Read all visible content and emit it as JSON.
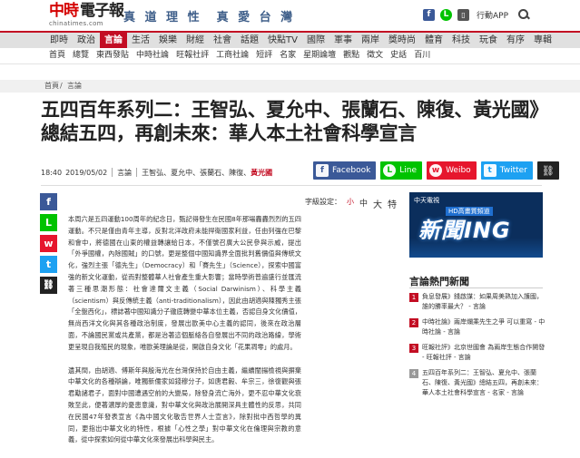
{
  "header": {
    "logo_main": "中時",
    "logo_sub": "電子報",
    "logo_url": "chinatimes.com",
    "slogan": "真 道 理 性　真 愛 台 灣",
    "app_label": "行動APP"
  },
  "nav": {
    "items": [
      "即時",
      "政治",
      "言論",
      "生活",
      "娛樂",
      "財經",
      "社會",
      "話題",
      "快點TV",
      "國際",
      "軍事",
      "兩岸",
      "獎時尚",
      "體育",
      "科技",
      "玩食",
      "有序",
      "專輯"
    ],
    "active_index": 2
  },
  "subnav": {
    "items": [
      "首頁",
      "總覽",
      "東西發貼",
      "中時社論",
      "旺報社評",
      "工商社論",
      "短評",
      "名家",
      "星期論壇",
      "觀點",
      "徵文",
      "史話",
      "百川"
    ]
  },
  "breadcrumb": {
    "home": "首頁",
    "section": "言論"
  },
  "article": {
    "title": "五四百年系列二：王智弘、夏允中、張蘭石、陳復、黃光國》總結五四，再創未來：華人本土社會科學宣言",
    "time": "18:40",
    "date": "2019/05/02",
    "category": "言論",
    "authors": "王智弘、夏允中、張蘭石、陳復、",
    "author_last": "黃光國",
    "font_size_label": "字級設定：",
    "font_sizes": [
      "小",
      "中",
      "大",
      "特"
    ],
    "paragraphs": [
      "本周六是五四運動100周年的紀念日，甄記得發生在民國8年那場轟轟烈烈的五四運動。不只是僅由青年主導，反對北洋政府未能捍衛國家利益，任由列強在巴黎和會中，將德國在山東的權益轉讓給日本，不僅號召廣大公民參與示威，提出「外爭國權，內除國賊」的口號，更是整個中國知識界全面批判舊價值與傳統文化，強烈主張「德先生」（Democracy）和「賽先生」（Science），探索中國富強的新文化運動，從而對整體華人社會產生重大影響；當時學術普遍盛行並匯流著三種思潮形態：社會達爾文主義（Social Darwinism）、科學主義（scientism）與反傳統主義（anti-traditionalism），因此由胡適與陳獨秀主張「全盤西化」，標誌著中國知識分子徹底轉變中華本位主義，否認自身文化價值，無尚西洋文化與其各種政治制度，發展出歐美中心主義的認同，後來在政治層面，不論國民黨或共產黨，都是治著這個脈絡各自發展出不同的政治路線，學術更呈現自我殖民的現象，唯歐美理論是從，開啟自身文化「花果凋零」的處月。",
      "遺其間，由胡適、傅斯年與殷海光在台灣保持於自由主義，繼續闡揚檢視與摒棄中華文化的各種辯論，唯獨新儒家如錢穆分子，如唐君毅、牟宗三，徐復觀與張君勱諸君子，面對中國遭遇空前的大變局，除發身流亡海外，更不忍中華文化衰敗至此，便著濃厚的憂患意識，對中華文化與政治展開深具主體性的反思，共同在民國47年發表宣言《為中國文化敬告世界人士宣言》，除對批中西哲學的異同，更指出中華文化的特性，根據「心性之學」對中華文化在倫理與宗教的意義，從中探索如何從中華文化來發展出科學與民主。"
    ]
  },
  "share": {
    "facebook": "Facebook",
    "line": "Line",
    "weibo": "Weibo",
    "twitter": "Twitter"
  },
  "ad": {
    "channel": "中天電視",
    "tag": "HD高畫質頻道",
    "headline": "新聞ING"
  },
  "hot": {
    "title": "言論熱門新聞",
    "items": [
      "負息發展》錢啟謀：如果周美熟加入護國，誰的勝率最大？ - 言論",
      "中時社論》兩岸爛乘先生之爭 可以重寫 - 中時社論 - 言論",
      "旺報社評》北京世國會 為兩岸生態合作開發 - 旺報社評 - 言論",
      "五四百年系列二：王智弘、夏允中、張蘭石、陳復、黃光國》總結五四，再創未來：華人本土社會科學宣言 - 名家 - 言論"
    ]
  },
  "colors": {
    "brand_red": "#c30d23",
    "facebook": "#3b5998",
    "line": "#00c300",
    "weibo": "#e6162d",
    "twitter": "#1da1f2"
  }
}
